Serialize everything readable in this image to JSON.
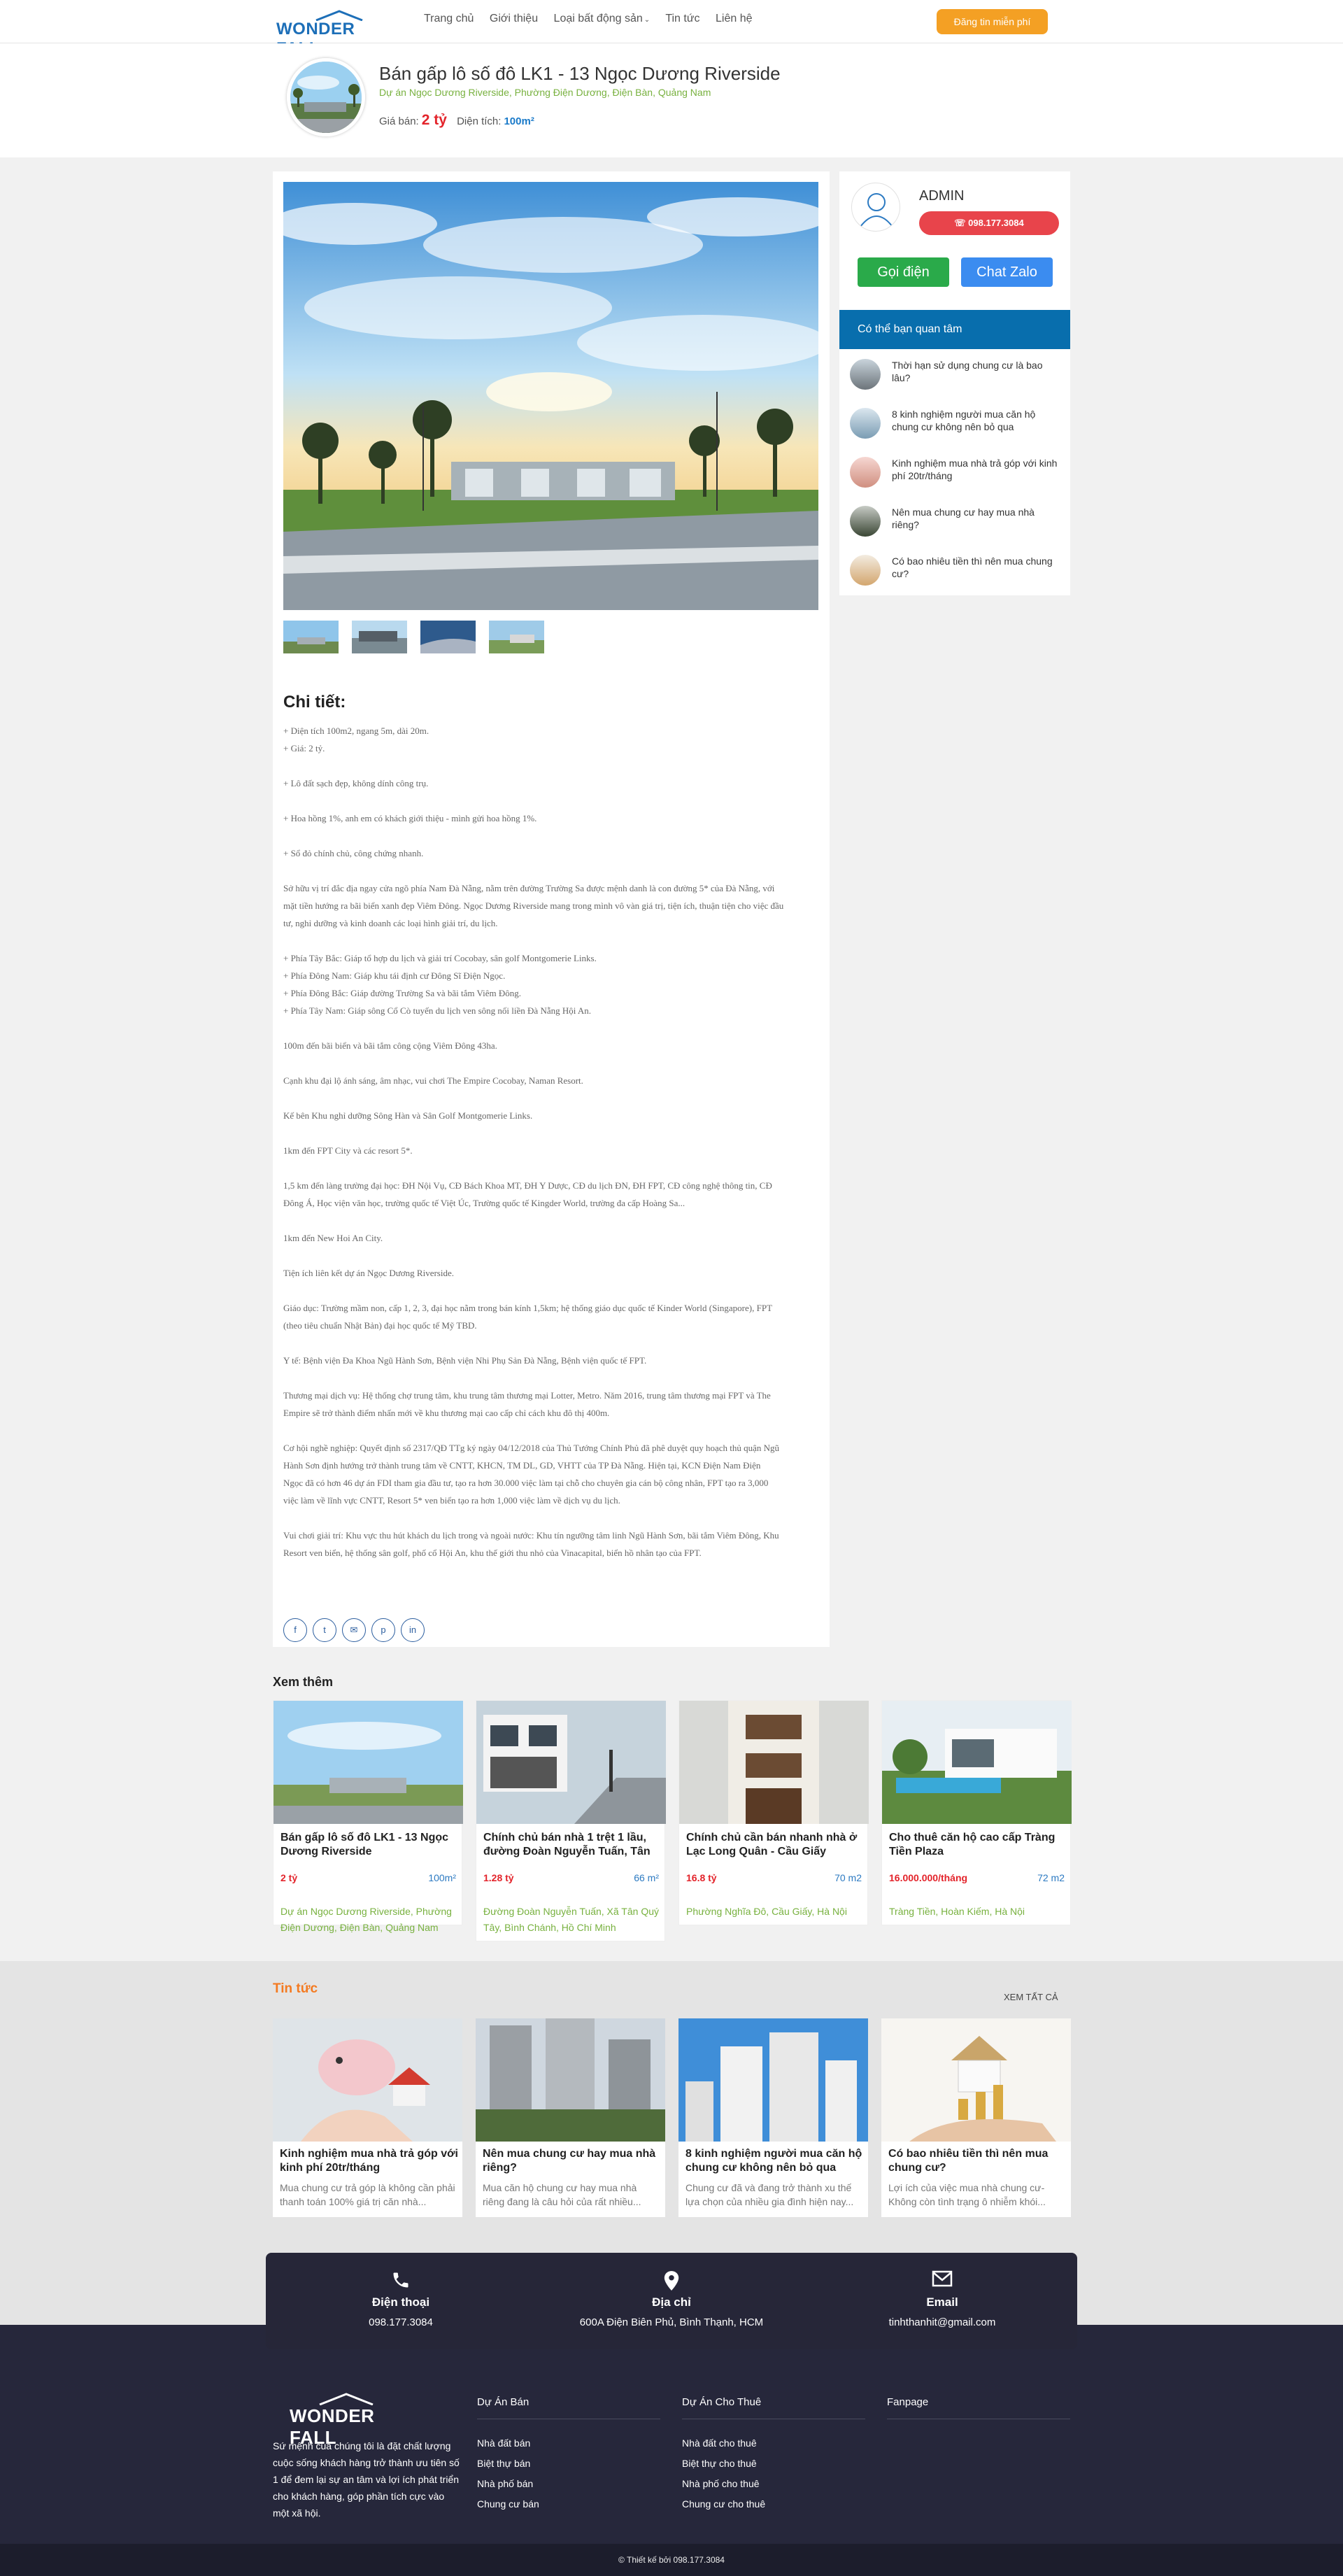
{
  "header": {
    "logo": "WONDER FALL",
    "nav": [
      "Trang chủ",
      "Giới thiệu",
      "Loại bất động sản",
      "Tin tức",
      "Liên hệ"
    ],
    "cta": "Đăng tin miễn phí"
  },
  "listing": {
    "title": "Bán gấp lô số đô LK1 - 13 Ngọc Dương Riverside",
    "address": "Dự án Ngọc Dương Riverside, Phường Điện Dương, Điện Bàn, Quảng Nam",
    "price_label": "Giá bán:",
    "price": "2 tỷ",
    "area_label": "Diện tích:",
    "area": "100m²"
  },
  "agent": {
    "name": "ADMIN",
    "phone": "098.177.3084",
    "call_btn": "Gọi điện",
    "zalo_btn": "Chat Zalo"
  },
  "interest": {
    "title": "Có thể bạn quan tâm",
    "items": [
      "Thời hạn sử dụng chung cư là bao lâu?",
      "8 kinh nghiệm người mua căn hộ chung cư không nên bỏ qua",
      "Kinh nghiệm mua nhà trả góp với kinh phí 20tr/tháng",
      "Nên mua chung cư hay mua nhà riêng?",
      "Có bao nhiêu tiền thì nên mua chung cư?"
    ]
  },
  "detail": {
    "heading": "Chi tiết:",
    "paragraphs": [
      [
        "+ Diện tích 100m2, ngang 5m, dài 20m.",
        "+ Giá: 2 tỷ."
      ],
      [
        "+ Lô đất sạch đẹp, không dính công trụ."
      ],
      [
        "+ Hoa hồng 1%, anh em có khách giới thiệu - mình gửi hoa hồng 1%."
      ],
      [
        "+ Sổ đỏ chính chủ, công chứng nhanh."
      ],
      [
        "Sở hữu vị trí đắc địa ngay cửa ngõ phía Nam Đà Nẵng, nằm trên đường Trường Sa được mệnh danh là con đường 5* của Đà Nẵng, với",
        "mặt tiền hướng ra bãi biển xanh đẹp Viêm Đông. Ngọc Dương Riverside mang trong mình vô vàn giá trị, tiện ích, thuận tiện cho việc đầu",
        "tư, nghỉ dưỡng và kinh doanh các loại hình giải trí, du lịch."
      ],
      [
        "+ Phía Tây Bắc: Giáp tổ hợp du lịch và giải trí Cocobay, sân golf Montgomerie Links.",
        "+ Phía Đông Nam: Giáp khu tái định cư Đông Sĩ Điện Ngọc.",
        "+ Phía Đông Bắc: Giáp đường Trường Sa và bãi tắm Viêm Đông.",
        "+ Phía Tây Nam: Giáp sông Cổ Cò tuyến du lịch ven sông nối liền Đà Nẵng Hội An."
      ],
      [
        "100m đến bãi biển và bãi tắm công cộng Viêm Đông 43ha."
      ],
      [
        "Cạnh khu đại lộ ánh sáng, âm nhạc, vui chơi The Empire Cocobay, Naman Resort."
      ],
      [
        "Kế bên Khu nghỉ dưỡng Sông Hàn và Sân Golf Montgomerie Links."
      ],
      [
        "1km đến FPT City và các resort 5*."
      ],
      [
        "1,5 km đến làng trường đại học: ĐH Nội Vụ, CĐ Bách Khoa MT, ĐH Y Dược, CĐ du lịch ĐN, ĐH FPT, CĐ công nghệ thông tin, CĐ",
        "Đông Á, Học viện văn học, trường quốc tế Việt Úc, Trường quốc tế Kingder World, trường đa cấp Hoàng Sa..."
      ],
      [
        "1km đến New Hoi An City."
      ],
      [
        "Tiện ích liên kết dự án Ngọc Dương Riverside."
      ],
      [
        "Giáo dục: Trường mầm non, cấp 1, 2, 3, đại học nằm trong bán kính 1,5km; hệ thống giáo dục quốc tế Kinder World (Singapore), FPT",
        "(theo tiêu chuẩn Nhật Bản) đại học quốc tế Mỹ TBD."
      ],
      [
        "Y tế: Bệnh viện Đa Khoa Ngũ Hành Sơn, Bệnh viện Nhi Phụ Sản Đà Nẵng, Bệnh viện quốc tế FPT."
      ],
      [
        "Thương mại dịch vụ: Hệ thống chợ trung tâm, khu trung tâm thương mại Lotter, Metro. Năm 2016, trung tâm thương mại FPT và The",
        "Empire sẽ trở thành điểm nhấn mới về khu thương mại cao cấp chỉ cách khu đô thị 400m."
      ],
      [
        "Cơ hội nghề nghiệp: Quyết định số 2317/QĐ TTg ký ngày 04/12/2018 của Thủ Tướng Chính Phủ đã phê duyệt quy hoạch thủ quận Ngũ",
        "Hành Sơn định hướng trở thành trung tâm về CNTT, KHCN, TM DL, GD, VHTT của TP Đà Nẵng. Hiện tại, KCN Điện Nam Điện",
        "Ngọc đã có hơn 46 dự án FDI tham gia đầu tư, tạo ra hơn 30.000 việc làm tại chỗ cho chuyên gia cán bộ công nhân, FPT tạo ra 3,000",
        "việc làm về lĩnh vực CNTT, Resort 5* ven biển tạo ra hơn 1,000 việc làm về dịch vụ du lịch."
      ],
      [
        "Vui chơi giải trí: Khu vực thu hút khách du lịch trong và ngoài nước: Khu tín ngưỡng tâm linh Ngũ Hành Sơn, bãi tắm Viêm Đông, Khu",
        "Resort ven biển, hệ thống sân golf, phố cổ Hội An, khu thế giới thu nhỏ của Vinacapital, biển hồ nhân tạo của FPT."
      ]
    ],
    "share": [
      "f",
      "t",
      "✉",
      "p",
      "in"
    ]
  },
  "related": {
    "title": "Xem thêm",
    "items": [
      {
        "name": "Bán gấp lô số đô LK1 - 13 Ngọc Dương Riverside",
        "price": "2 tỷ",
        "area": "100m²",
        "address": "Dự án Ngọc Dương Riverside, Phường Điện Dương, Điện Bàn, Quảng Nam"
      },
      {
        "name": "Chính chủ bán nhà 1 trệt 1 lầu, đường Đoàn Nguyễn Tuấn, Tân",
        "price": "1.28 tỷ",
        "area": "66 m²",
        "address": "Đường Đoàn Nguyễn Tuấn, Xã Tân Quý Tây, Bình Chánh, Hồ Chí Minh"
      },
      {
        "name": "Chính chủ cần bán nhanh nhà ở Lạc Long Quân - Cầu Giấy",
        "price": "16.8 tỷ",
        "area": "70 m2",
        "address": "Phường Nghĩa Đô, Cầu Giấy, Hà Nội"
      },
      {
        "name": "Cho thuê căn hộ cao cấp Tràng Tiền Plaza",
        "price": "16.000.000/tháng",
        "area": "72 m2",
        "address": "Tràng Tiền, Hoàn Kiếm, Hà Nội"
      }
    ]
  },
  "news": {
    "title": "Tin tức",
    "see_all": "XEM TẤT CẢ",
    "items": [
      {
        "name": "Kinh nghiệm mua nhà trả góp với kinh phí 20tr/tháng",
        "summary": "Mua chung cư trả góp là không cần phải thanh toán 100% giá trị căn nhà..."
      },
      {
        "name": "Nên mua chung cư hay mua nhà riêng?",
        "summary": "Mua căn hộ chung cư hay mua nhà riêng đang là câu hỏi của rất nhiều..."
      },
      {
        "name": "8 kinh nghiệm người mua căn hộ chung cư không nên bỏ qua",
        "summary": "Chung cư đã và đang trở thành xu thế lựa chọn của nhiều gia đình hiện nay..."
      },
      {
        "name": "Có bao nhiêu tiền thì nên mua chung cư?",
        "summary": "Lợi ích của việc mua nhà chung cư­Không còn tình trạng ô nhiễm khói..."
      }
    ]
  },
  "contact": {
    "phone_label": "Điện thoại",
    "phone": "098.177.3084",
    "address_label": "Địa chỉ",
    "address": "600A Điện Biên Phủ, Bình Thạnh, HCM",
    "email_label": "Email",
    "email": "tinhthanhit@gmail.com"
  },
  "footer": {
    "logo": "WONDER FALL",
    "about": "Sứ mệnh của chúng tôi là đặt chất lượng cuộc sống khách hàng trở thành ưu tiên số 1 để đem lại sự an tâm và lợi ích phát triển cho khách hàng, góp phần tích cực vào một xã hội.",
    "col1": {
      "title": "Dự Án Bán",
      "links": [
        "Nhà đất bán",
        "Biệt thự bán",
        "Nhà phố bán",
        "Chung cư bán"
      ]
    },
    "col2": {
      "title": "Dự Án Cho Thuê",
      "links": [
        "Nhà đất cho thuê",
        "Biệt thự cho thuê",
        "Nhà phố cho thuê",
        "Chung cư cho thuê"
      ]
    },
    "col3": {
      "title": "Fanpage"
    },
    "copyright": "© Thiết kế bởi 098.177.3084"
  },
  "colors": {
    "brand": "#1d6fb8",
    "accent": "#f4a024",
    "price": "#e3242b",
    "address": "#78b13f",
    "call": "#2aaa4a",
    "zalo": "#3b8cf0",
    "interest": "#086ead",
    "footer": "#26273b"
  }
}
